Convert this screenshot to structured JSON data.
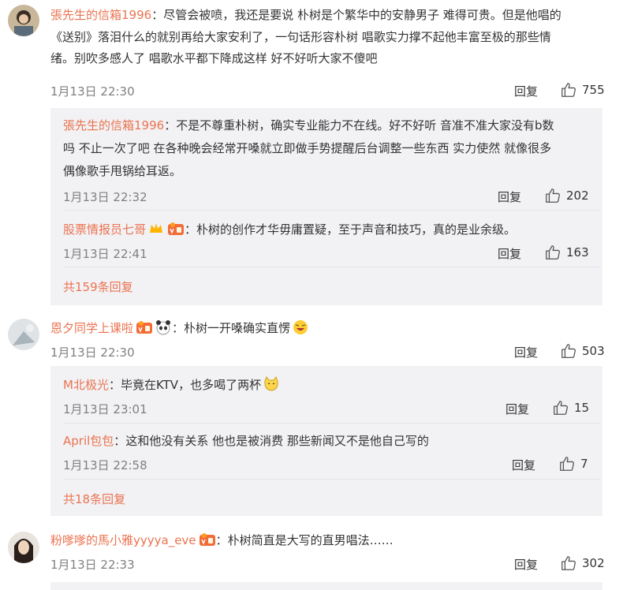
{
  "comments": [
    {
      "user": "張先生的信箱1996",
      "sep": "：",
      "text_lines": [
        "尽管会被喷，我还是要说 朴树是个繁华中的安静男子 难得可贵。但是他唱的",
        "《送别》落泪什么的就别再给大家安利了，一句话形容朴树 唱歌实力撑不起他丰富至极的那些情",
        "绪。别吹多感人了 唱歌水平都下降成这样 好不好听大家不傻吧"
      ],
      "time": "1月13日 22:30",
      "reply": "回复",
      "likes": "755",
      "replies": [
        {
          "user": "張先生的信箱1996",
          "sep": "：",
          "text_lines": [
            "不是不尊重朴树，确实专业能力不在线。好不好听 音准不准大家没有b数",
            "吗 不止一次了吧 在各种晚会经常开嗓就立即做手势提醒后台调整一些东西 实力使然 就像很多",
            "偶像歌手甩锅给耳返。"
          ],
          "time": "1月13日 22:32",
          "reply": "回复",
          "likes": "202"
        },
        {
          "user": "股票情报员七哥",
          "sep": "：",
          "text_lines": [
            "朴树的创作才华毋庸置疑，至于声音和技巧，真的是业余级。"
          ],
          "time": "1月13日 22:41",
          "reply": "回复",
          "likes": "163"
        }
      ],
      "more": "共159条回复"
    },
    {
      "user": "恩夕同学上课啦",
      "sep": "：",
      "text_lines": [
        "朴树一开嗓确实直愣"
      ],
      "time": "1月13日 22:30",
      "reply": "回复",
      "likes": "503",
      "replies": [
        {
          "user": "M北极光",
          "sep": "：",
          "text_lines": [
            "毕竟在KTV，也多喝了两杯"
          ],
          "time": "1月13日 23:01",
          "reply": "回复",
          "likes": "15"
        },
        {
          "user": "April包包",
          "sep": "：",
          "text_lines": [
            "这和他没有关系 他也是被消费 那些新闻又不是他自己写的"
          ],
          "time": "1月13日 22:58",
          "reply": "回复",
          "likes": "7"
        }
      ],
      "more": "共18条回复"
    },
    {
      "user": "粉嗲嗲的馬小雅yyyya_eve",
      "sep": "：",
      "text_lines": [
        "朴树简直是大写的直男唱法……"
      ],
      "time": "1月13日 22:33",
      "reply": "回复",
      "likes": "302"
    }
  ],
  "colors": {
    "username": "#eb7350",
    "meta": "#808080",
    "reply_bg": "#f2f2f5"
  },
  "icons": {
    "like": "thumb-up-icon",
    "vip_badge": "vip-badge-icon",
    "crown": "crown-icon"
  }
}
